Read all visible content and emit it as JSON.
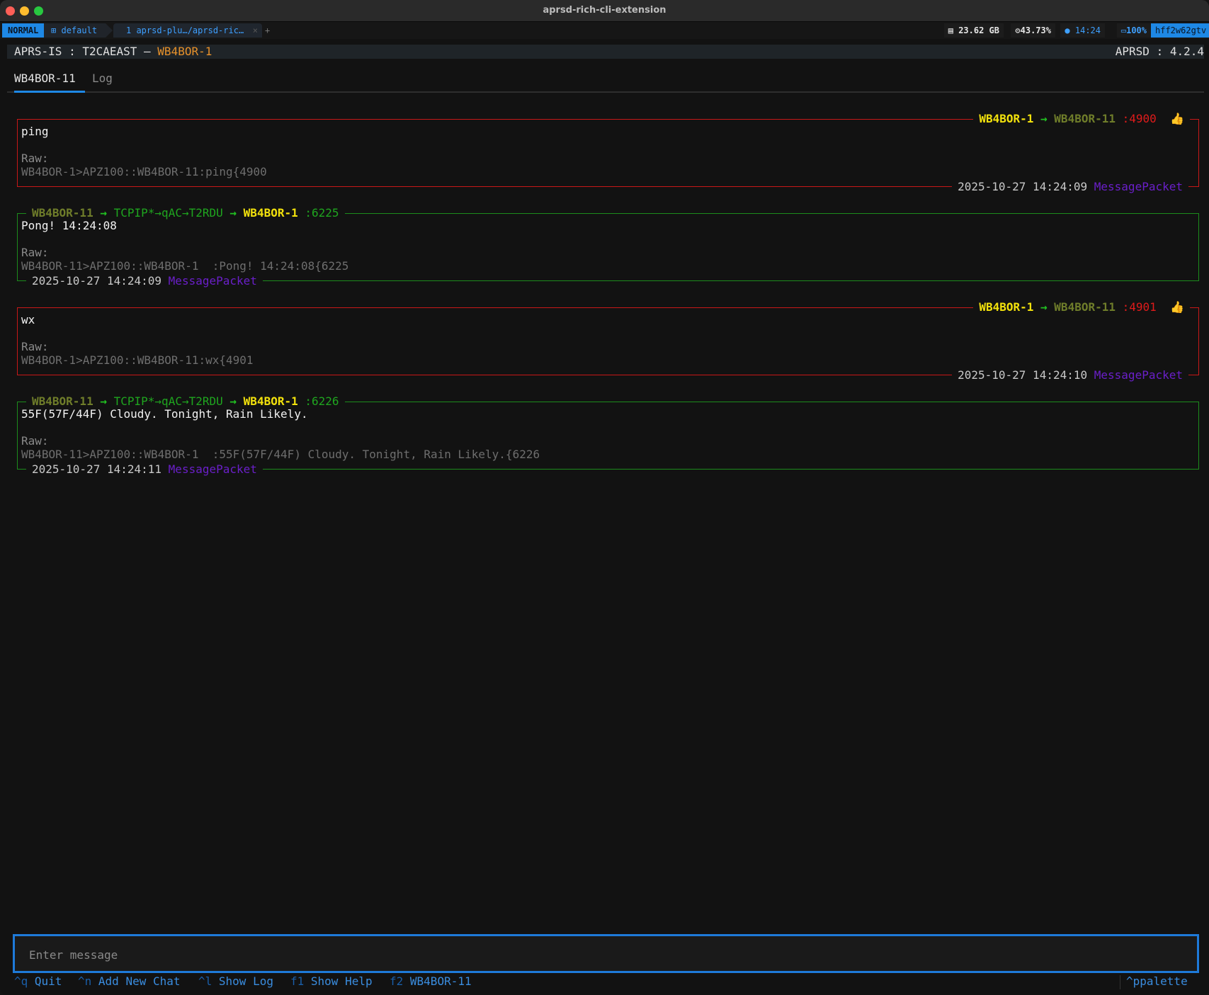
{
  "window": {
    "title": "aprsd-rich-cli-extension"
  },
  "tabbar": {
    "mode": "NORMAL",
    "session_icon": "grid-icon",
    "session": "default",
    "tab_label": "1 aprsd-plu…/aprsd-ric…",
    "tab_close": "×",
    "new_tab": "+",
    "memory": "23.62 GB",
    "cpu": "43.73%",
    "clock": "14:24",
    "battery": "100%",
    "hostname": "hff2w62gtv"
  },
  "header": {
    "prefix": "APRS-IS : T2CAEAST — ",
    "callsign": "WB4BOR-1",
    "version": "APRSD : 4.2.4"
  },
  "tabs": {
    "active": "WB4BOR-11",
    "inactive": "Log"
  },
  "messages": [
    {
      "direction": "outgoing",
      "from": "WB4BOR-1",
      "arrow": "→",
      "to": "WB4BOR-11",
      "msgno": ":4900",
      "ack_icon": "👍",
      "text": "ping",
      "raw_label": "Raw:",
      "raw": "WB4BOR-1>APZ100::WB4BOR-11:ping{4900",
      "timestamp": "2025-10-27 14:24:09",
      "packet_type": "MessagePacket"
    },
    {
      "direction": "incoming",
      "from": "WB4BOR-11",
      "arrow": "→",
      "path": "TCPIP*→qAC→T2RDU",
      "arrow2": "→",
      "to": "WB4BOR-1",
      "msgno": ":6225",
      "text": "Pong! 14:24:08",
      "raw_label": "Raw:",
      "raw": "WB4BOR-11>APZ100::WB4BOR-1  :Pong! 14:24:08{6225",
      "timestamp": "2025-10-27 14:24:09",
      "packet_type": "MessagePacket"
    },
    {
      "direction": "outgoing",
      "from": "WB4BOR-1",
      "arrow": "→",
      "to": "WB4BOR-11",
      "msgno": ":4901",
      "ack_icon": "👍",
      "text": "wx",
      "raw_label": "Raw:",
      "raw": "WB4BOR-1>APZ100::WB4BOR-11:wx{4901",
      "timestamp": "2025-10-27 14:24:10",
      "packet_type": "MessagePacket"
    },
    {
      "direction": "incoming",
      "from": "WB4BOR-11",
      "arrow": "→",
      "path": "TCPIP*→qAC→T2RDU",
      "arrow2": "→",
      "to": "WB4BOR-1",
      "msgno": ":6226",
      "text": "55F(57F/44F) Cloudy. Tonight, Rain Likely.",
      "raw_label": "Raw:",
      "raw": "WB4BOR-11>APZ100::WB4BOR-1  :55F(57F/44F) Cloudy. Tonight, Rain Likely.{6226",
      "timestamp": "2025-10-27 14:24:11",
      "packet_type": "MessagePacket"
    }
  ],
  "input": {
    "placeholder": "Enter message"
  },
  "footer": {
    "items": [
      {
        "key": "^q",
        "label": "Quit"
      },
      {
        "key": "^n",
        "label": "Add New Chat"
      },
      {
        "key": "^l",
        "label": "Show Log"
      },
      {
        "key": "f1",
        "label": "Show Help"
      },
      {
        "key": "f2",
        "label": "WB4BOR-11"
      }
    ],
    "palette": "^ppalette"
  },
  "colors": {
    "accent": "#1e88e5",
    "outgoing_border": "#c81818",
    "incoming_border": "#1c8c1c",
    "callsign_yellow": "#f2e10c",
    "packet_type_purple": "#6a1fc9",
    "header_callsign": "#e6912b"
  }
}
